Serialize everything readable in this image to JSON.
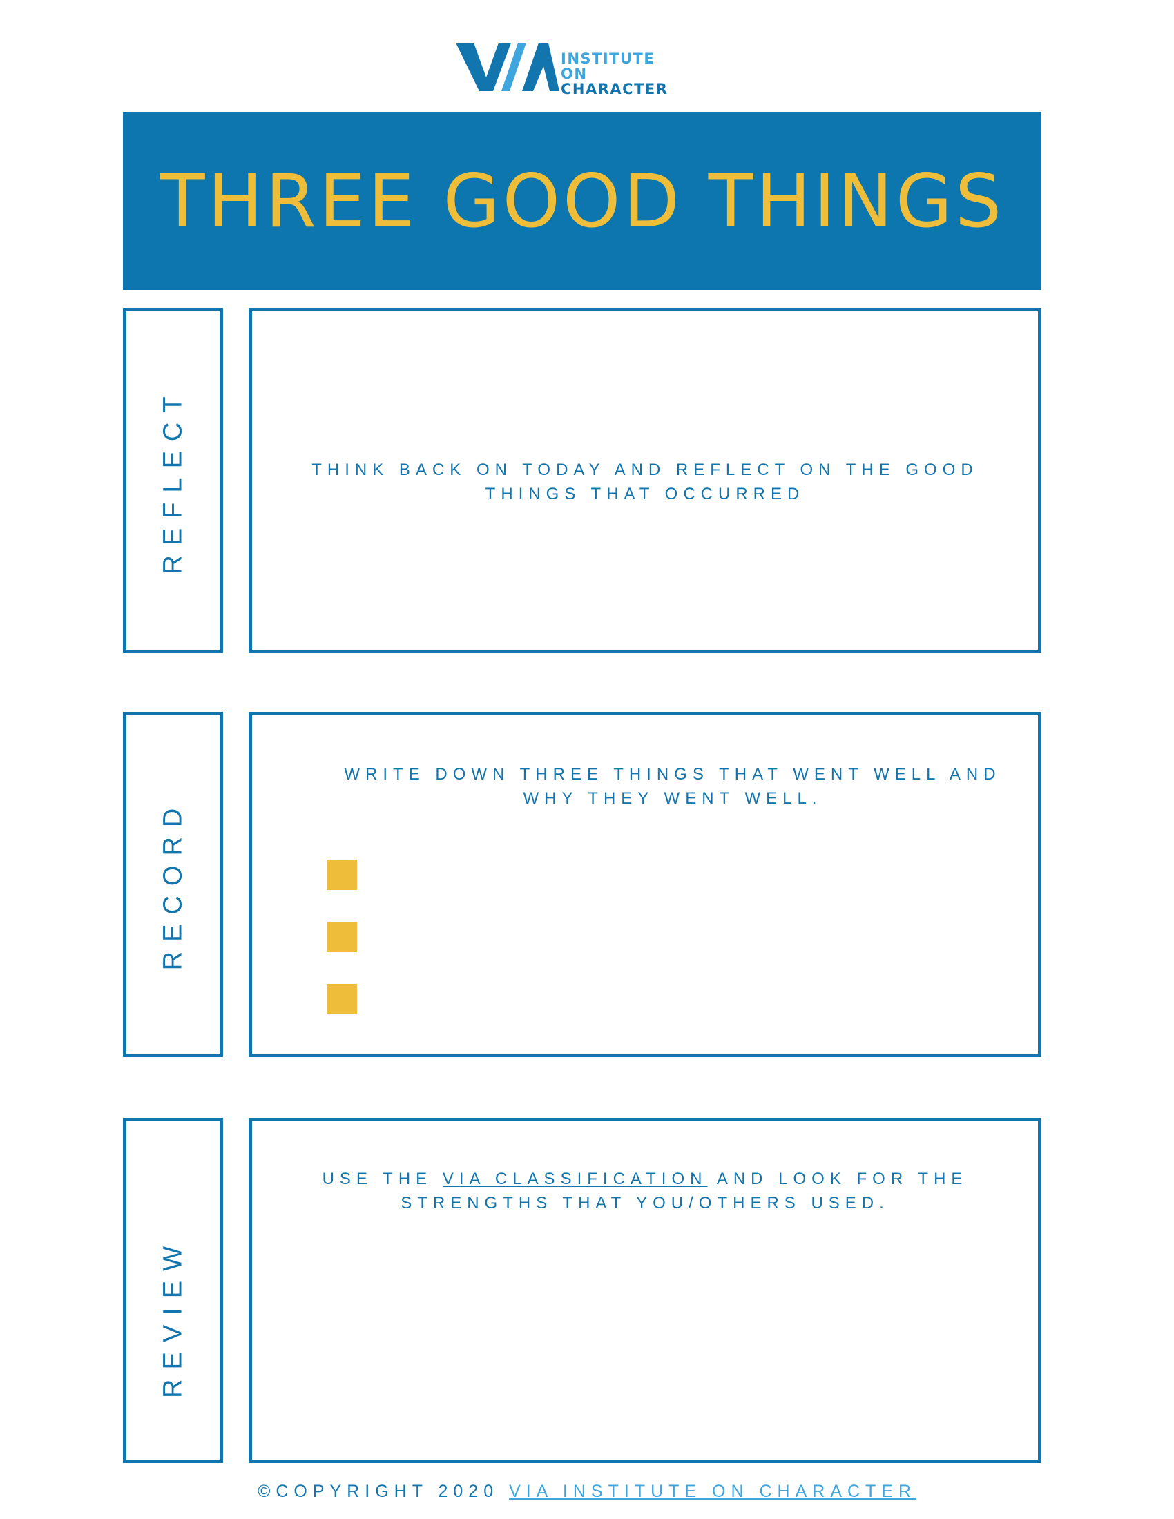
{
  "logo": {
    "mark": "VIA",
    "line1": "INSTITUTE ON",
    "line2": "CHARACTER"
  },
  "header": {
    "title": "THREE GOOD THINGS"
  },
  "sections": [
    {
      "label": "REFLECT",
      "instruction_line1": "THINK BACK ON TODAY AND REFLECT ON THE GOOD",
      "instruction_line2": "THINGS THAT OCCURRED"
    },
    {
      "label": "RECORD",
      "instruction_line1": "WRITE DOWN THREE THINGS THAT WENT WELL AND",
      "instruction_line2": "WHY THEY WENT WELL.",
      "bullet_icon": "yellow-square-icon"
    },
    {
      "label": "REVIEW",
      "instruction_pre": "USE THE ",
      "instruction_link": "VIA CLASSIFICATION",
      "instruction_post": " AND LOOK FOR THE",
      "instruction_line2": "STRENGTHS THAT YOU/OTHERS USED."
    }
  ],
  "footer": {
    "copyright": "©COPYRIGHT 2020 ",
    "link": "VIA INSTITUTE ON CHARACTER"
  },
  "colors": {
    "primary_blue": "#1375ae",
    "banner_blue": "#0e76ae",
    "light_blue": "#3fa6dd",
    "accent_yellow": "#eebe3b"
  }
}
